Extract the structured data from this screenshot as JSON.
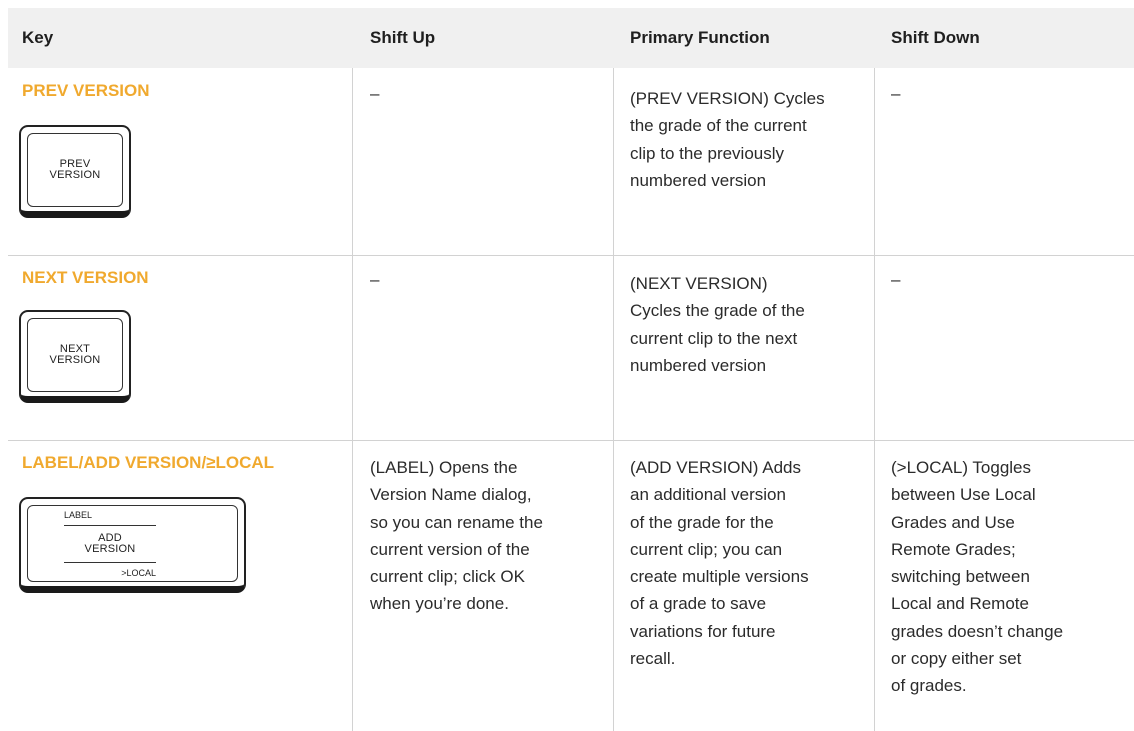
{
  "headers": {
    "key": "Key",
    "shift_up": "Shift Up",
    "primary": "Primary Function",
    "shift_down": "Shift Down"
  },
  "rows": [
    {
      "key_title": "PREV VERSION",
      "keycap_lines": [
        "PREV",
        "VERSION"
      ],
      "shift_up": "–",
      "primary_lines": [
        "(PREV VERSION) Cycles",
        "the grade of the current",
        "clip to the previously",
        "numbered version"
      ],
      "shift_down": "–"
    },
    {
      "key_title": "NEXT VERSION",
      "keycap_lines": [
        "NEXT",
        "VERSION"
      ],
      "shift_up": "–",
      "primary_lines": [
        "(NEXT VERSION)",
        "Cycles the grade of the",
        "current clip to the next",
        "numbered version"
      ],
      "shift_down": "–"
    },
    {
      "key_title": "LABEL/ADD VERSION/≥LOCAL",
      "keycap_top": "LABEL",
      "keycap_lines": [
        "ADD",
        "VERSION"
      ],
      "keycap_bottom": ">LOCAL",
      "shift_up_lines": [
        "(LABEL) Opens the",
        "Version Name dialog,",
        "so you can rename the",
        "current version of the",
        "current clip; click OK",
        "when you’re done."
      ],
      "primary_lines": [
        "(ADD VERSION) Adds",
        "an additional version",
        "of the grade for the",
        "current clip; you can",
        "create multiple versions",
        "of a grade to save",
        "variations for future",
        "recall."
      ],
      "shift_down_lines": [
        "(>LOCAL) Toggles",
        "between Use Local",
        "Grades and Use",
        "Remote Grades;",
        "switching between",
        "Local and Remote",
        "grades doesn’t change",
        "or copy either set",
        "of grades."
      ]
    }
  ]
}
